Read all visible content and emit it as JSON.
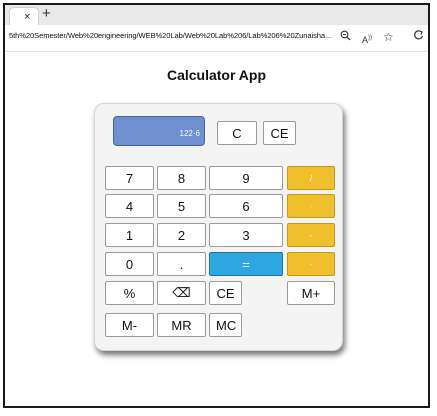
{
  "browser": {
    "tab_close": "×",
    "new_tab": "+",
    "url": "5th%20Semester/Web%20engineering/WEB%20Lab/Web%20Lab%206/Lab%206%20Zunaisha...",
    "icons": [
      "zoom-out-icon",
      "read-aloud-icon",
      "favorite-star-icon",
      "browser-essentials-icon"
    ]
  },
  "app": {
    "title": "Calculator App"
  },
  "display": {
    "value": "122·6"
  },
  "keys": {
    "clear": "C",
    "clear_entry": "CE",
    "digits": {
      "d7": "7",
      "d8": "8",
      "d9": "9",
      "d4": "4",
      "d5": "5",
      "d6": "6",
      "d1": "1",
      "d2": "2",
      "d3": "3",
      "d0": "0",
      "dot": "."
    },
    "operators": {
      "divide": "/",
      "multiply": "·",
      "subtract": "-",
      "add": "·"
    },
    "equals": "=",
    "percent": "%",
    "backspace": "⌫",
    "ce2": "CE",
    "memory": {
      "m_plus": "M+",
      "m_minus": "M-",
      "m_recall": "MR",
      "m_clear": "MC"
    }
  },
  "colors": {
    "display": "#6f8fd0",
    "operator": "#f0bf2c",
    "equals": "#2ea7e0"
  }
}
